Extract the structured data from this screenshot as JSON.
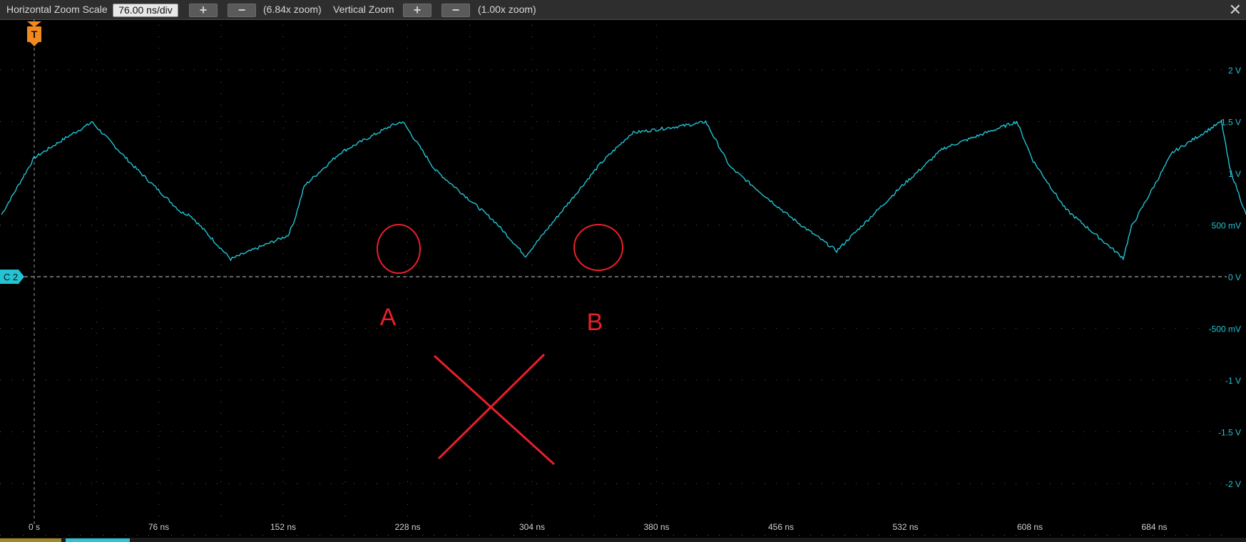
{
  "toolbar": {
    "h_zoom_label": "Horizontal Zoom Scale",
    "h_zoom_value": "76.00 ns/div",
    "plus": "+",
    "minus": "−",
    "h_zoom_info": "(6.84x zoom)",
    "v_zoom_label": "Vertical Zoom",
    "v_zoom_info": "(1.00x zoom)",
    "close": "✕"
  },
  "trigger_marker": "T",
  "channel_marker": "C 2",
  "colors": {
    "trace": "#22c4d4",
    "annotation": "#e8202a",
    "trigger": "#f08a1e",
    "grid": "#5a5a5a"
  },
  "y_labels": [
    "2 V",
    "1.5 V",
    "1 V",
    "500 mV",
    "0 V",
    "-500 mV",
    "-1 V",
    "-1.5 V",
    "-2 V"
  ],
  "x_labels": [
    "0 s",
    "76 ns",
    "152 ns",
    "228 ns",
    "304 ns",
    "380 ns",
    "456 ns",
    "532 ns",
    "608 ns",
    "684 ns"
  ],
  "annotations": {
    "label_a": "A",
    "label_b": "B"
  },
  "chart_data": {
    "type": "line",
    "series": [
      {
        "x_ns": [
          -20,
          0,
          20,
          34,
          35,
          60,
          90,
          95,
          120,
          155,
          159,
          165,
          187,
          218,
          225,
          245,
          280,
          282,
          300,
          345,
          350,
          365,
          405,
          410,
          425,
          460,
          470,
          490,
          530,
          535,
          555,
          600,
          610,
          630,
          665,
          670,
          695,
          725,
          730,
          740
        ],
        "y_v": [
          0.6,
          1.15,
          1.35,
          1.48,
          1.5,
          1.08,
          0.62,
          0.6,
          0.17,
          0.4,
          0.55,
          0.88,
          1.2,
          1.46,
          1.5,
          1.03,
          0.55,
          0.52,
          0.2,
          1.08,
          1.16,
          1.39,
          1.48,
          1.5,
          1.06,
          0.6,
          0.48,
          0.25,
          0.88,
          0.95,
          1.24,
          1.5,
          1.12,
          0.65,
          0.18,
          0.48,
          1.2,
          1.5,
          1.05,
          0.6
        ]
      }
    ],
    "xlim": [
      -20,
      740
    ],
    "ylim": [
      -2.5,
      2.5
    ]
  }
}
